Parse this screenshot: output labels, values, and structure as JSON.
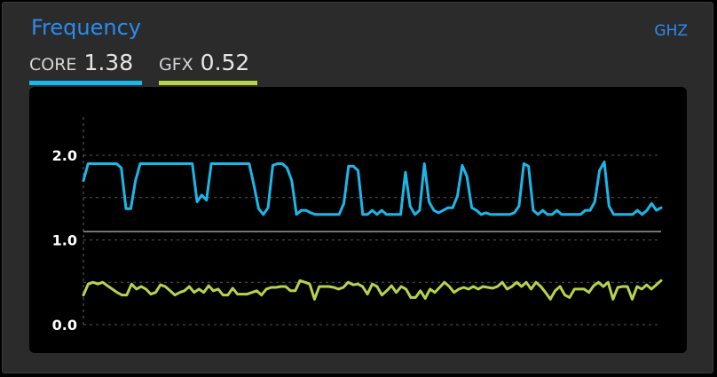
{
  "header": {
    "title": "Frequency",
    "unit": "GHZ"
  },
  "metrics": [
    {
      "label": "CORE",
      "value": "1.38",
      "color": "#1ab8ea"
    },
    {
      "label": "GFX",
      "value": "0.52",
      "color": "#b5d44b"
    }
  ],
  "chart_data": {
    "type": "line",
    "ylim": [
      0.0,
      2.45
    ],
    "yticks": [
      {
        "value": 2.0,
        "label": "2.0"
      },
      {
        "value": 1.0,
        "label": "1.0"
      },
      {
        "value": 0.0,
        "label": "0.0"
      }
    ],
    "grid": true,
    "reference_line": 1.1,
    "series": [
      {
        "color": "#1ab8ea",
        "values": [
          1.7,
          1.9,
          1.9,
          1.9,
          1.9,
          1.9,
          1.9,
          1.9,
          1.85,
          1.37,
          1.37,
          1.7,
          1.9,
          1.9,
          1.9,
          1.9,
          1.9,
          1.9,
          1.9,
          1.9,
          1.9,
          1.9,
          1.9,
          1.9,
          1.45,
          1.53,
          1.47,
          1.9,
          1.9,
          1.9,
          1.9,
          1.9,
          1.9,
          1.9,
          1.9,
          1.9,
          1.65,
          1.37,
          1.3,
          1.38,
          1.88,
          1.9,
          1.9,
          1.85,
          1.7,
          1.3,
          1.35,
          1.35,
          1.32,
          1.3,
          1.3,
          1.3,
          1.3,
          1.3,
          1.3,
          1.43,
          1.87,
          1.87,
          1.82,
          1.3,
          1.3,
          1.35,
          1.3,
          1.35,
          1.3,
          1.3,
          1.3,
          1.3,
          1.8,
          1.4,
          1.3,
          1.35,
          1.9,
          1.45,
          1.35,
          1.32,
          1.35,
          1.38,
          1.38,
          1.52,
          1.88,
          1.75,
          1.38,
          1.35,
          1.3,
          1.32,
          1.3,
          1.3,
          1.3,
          1.3,
          1.3,
          1.32,
          1.4,
          1.9,
          1.87,
          1.35,
          1.3,
          1.35,
          1.3,
          1.3,
          1.35,
          1.3,
          1.3,
          1.3,
          1.3,
          1.3,
          1.35,
          1.35,
          1.45,
          1.82,
          1.92,
          1.4,
          1.3,
          1.3,
          1.3,
          1.3,
          1.3,
          1.35,
          1.3,
          1.35,
          1.43,
          1.35,
          1.38
        ]
      },
      {
        "color": "#b5d44b",
        "values": [
          0.35,
          0.48,
          0.5,
          0.48,
          0.5,
          0.46,
          0.42,
          0.38,
          0.35,
          0.35,
          0.48,
          0.42,
          0.45,
          0.42,
          0.36,
          0.38,
          0.47,
          0.45,
          0.4,
          0.35,
          0.38,
          0.4,
          0.45,
          0.38,
          0.42,
          0.38,
          0.46,
          0.4,
          0.42,
          0.35,
          0.35,
          0.43,
          0.36,
          0.36,
          0.36,
          0.38,
          0.4,
          0.35,
          0.42,
          0.44,
          0.44,
          0.45,
          0.45,
          0.4,
          0.4,
          0.52,
          0.5,
          0.48,
          0.3,
          0.45,
          0.45,
          0.45,
          0.44,
          0.42,
          0.44,
          0.5,
          0.47,
          0.48,
          0.45,
          0.36,
          0.48,
          0.45,
          0.35,
          0.4,
          0.46,
          0.38,
          0.45,
          0.42,
          0.32,
          0.32,
          0.4,
          0.31,
          0.42,
          0.38,
          0.44,
          0.5,
          0.45,
          0.38,
          0.42,
          0.44,
          0.42,
          0.45,
          0.42,
          0.45,
          0.44,
          0.43,
          0.45,
          0.5,
          0.42,
          0.45,
          0.5,
          0.45,
          0.5,
          0.42,
          0.5,
          0.45,
          0.38,
          0.3,
          0.4,
          0.45,
          0.35,
          0.32,
          0.42,
          0.42,
          0.42,
          0.38,
          0.46,
          0.5,
          0.45,
          0.5,
          0.3,
          0.44,
          0.45,
          0.45,
          0.3,
          0.45,
          0.42,
          0.47,
          0.42,
          0.47,
          0.52
        ]
      }
    ]
  }
}
